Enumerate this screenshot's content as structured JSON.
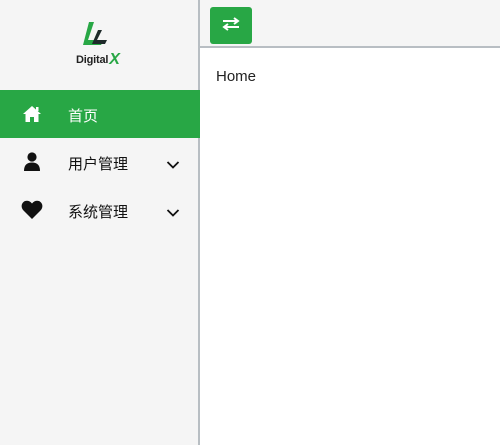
{
  "logo": {
    "name": "Digital",
    "mark": "X",
    "alt": "Digital X logo"
  },
  "menu": [
    {
      "label": "首页",
      "icon": "home-icon",
      "active": true
    },
    {
      "label": "用户管理",
      "icon": "user-icon",
      "expandable": true
    },
    {
      "label": "系统管理",
      "icon": "heart-icon",
      "expandable": true
    }
  ],
  "toolbar": {
    "toggle_icon": "swap-arrows-icon"
  },
  "main": {
    "content": "Home"
  },
  "colors": {
    "accent": "#28a745",
    "sidebar_bg": "#f5f5f5",
    "border": "#b8bec3"
  }
}
